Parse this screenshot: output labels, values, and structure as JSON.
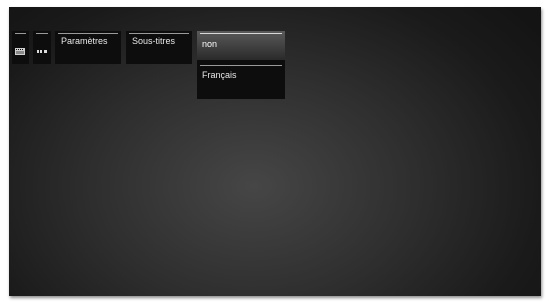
{
  "menu": {
    "settings_label": "Paramètres",
    "subtitles_label": "Sous-titres",
    "options": [
      {
        "label": "non",
        "selected": true
      },
      {
        "label": "Français",
        "selected": false
      }
    ]
  },
  "icons": {
    "first": "film-strip-icon",
    "second": "dots-icon"
  },
  "colors": {
    "panel_bg": "#0d0d0d",
    "selected_bg": "#4a4a4a",
    "text": "#e8e8e8"
  }
}
